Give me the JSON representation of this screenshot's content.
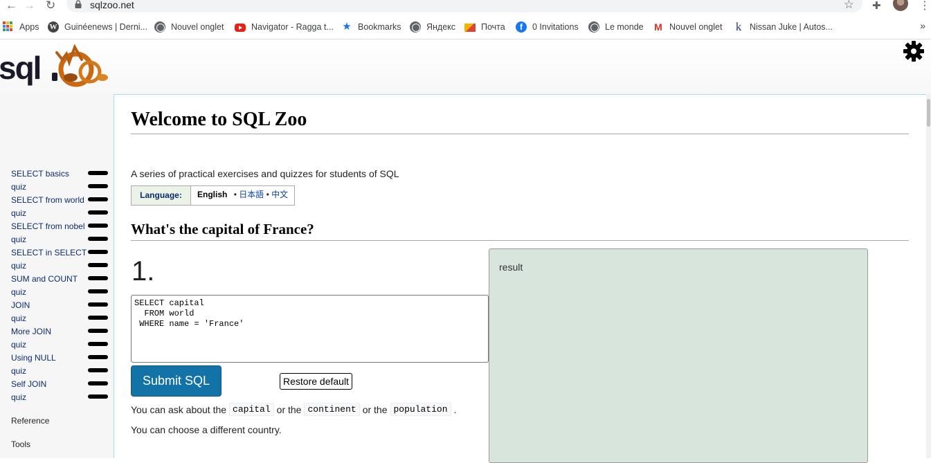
{
  "browser": {
    "url": "sqlzoo.net",
    "bookmarks": [
      {
        "label": "Apps",
        "icon": "apps-grid-icon"
      },
      {
        "label": "Guinéenews | Derni...",
        "icon": "wordpress-icon"
      },
      {
        "label": "Nouvel onglet",
        "icon": "globe-icon"
      },
      {
        "label": "Navigator - Ragga t...",
        "icon": "youtube-icon"
      },
      {
        "label": "Bookmarks",
        "icon": "star-icon"
      },
      {
        "label": "Яндекс",
        "icon": "globe-icon"
      },
      {
        "label": "Почта",
        "icon": "mail-icon"
      },
      {
        "label": "0 Invitations",
        "icon": "facebook-icon"
      },
      {
        "label": "Le monde",
        "icon": "globe-icon"
      },
      {
        "label": "Nouvel onglet",
        "icon": "gmail-icon"
      },
      {
        "label": "Nissan Juke | Autos...",
        "icon": "k-icon"
      }
    ],
    "more": "»"
  },
  "sidebar": {
    "items": [
      {
        "label": "SELECT basics"
      },
      {
        "label": "quiz"
      },
      {
        "label": "SELECT from world"
      },
      {
        "label": "quiz"
      },
      {
        "label": "SELECT from nobel"
      },
      {
        "label": "quiz"
      },
      {
        "label": "SELECT in SELECT"
      },
      {
        "label": "quiz"
      },
      {
        "label": "SUM and COUNT"
      },
      {
        "label": "quiz"
      },
      {
        "label": "JOIN"
      },
      {
        "label": "quiz"
      },
      {
        "label": "More JOIN"
      },
      {
        "label": "quiz"
      },
      {
        "label": "Using NULL"
      },
      {
        "label": "quiz"
      },
      {
        "label": "Self JOIN"
      },
      {
        "label": "quiz"
      }
    ],
    "reference": "Reference",
    "tools": "Tools"
  },
  "main": {
    "title": "Welcome to SQL Zoo",
    "intro": "A series of practical exercises and quizzes for students of SQL",
    "language": {
      "label": "Language:",
      "current": "English",
      "sep": "•",
      "options": [
        "日本語",
        "中文"
      ]
    },
    "question_title": "What's the capital of France?",
    "question_number": "1.",
    "sql": "SELECT capital\n  FROM world\n WHERE name = 'France'",
    "submit_label": "Submit SQL",
    "restore_label": "Restore default",
    "hint": {
      "prefix": "You can ask about the",
      "code1": "capital",
      "or1": "or the",
      "code2": "continent",
      "or2": "or the",
      "code3": "population",
      "suffix": "."
    },
    "hint2": "You can choose a different country.",
    "result_label": "result"
  },
  "colors": {
    "link": "#0b2b70",
    "submit": "#1373a6",
    "result_bg": "#d8e5dc",
    "language_label_bg": "#eaf3e6"
  }
}
